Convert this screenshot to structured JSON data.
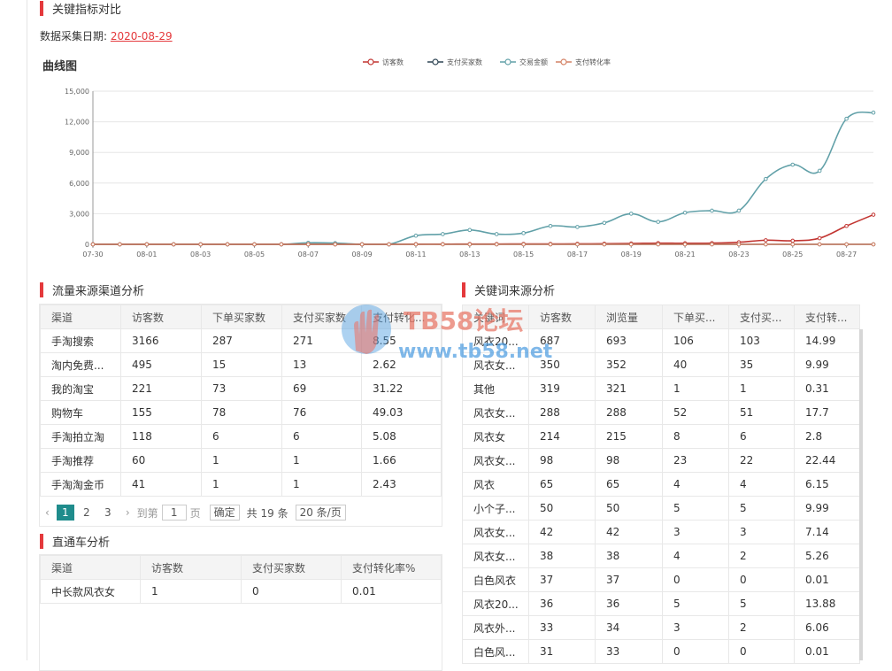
{
  "header": {
    "title": "关键指标对比",
    "date_label": "数据采集日期:",
    "date_value": "2020-08-29"
  },
  "chart": {
    "heading": "曲线图"
  },
  "chart_data": {
    "type": "line",
    "legend": [
      "访客数",
      "支付买家数",
      "交易金额",
      "支付转化率"
    ],
    "legend_position": "top-center",
    "colors": [
      "#c23531",
      "#2f4554",
      "#61a0a8",
      "#d48265"
    ],
    "x": [
      "07-30",
      "07-31",
      "08-01",
      "08-02",
      "08-03",
      "08-04",
      "08-05",
      "08-06",
      "08-07",
      "08-08",
      "08-09",
      "08-10",
      "08-11",
      "08-12",
      "08-13",
      "08-14",
      "08-15",
      "08-16",
      "08-17",
      "08-18",
      "08-19",
      "08-20",
      "08-21",
      "08-22",
      "08-23",
      "08-24",
      "08-25",
      "08-26",
      "08-27",
      "08-28"
    ],
    "x_tick_labels": [
      "07-30",
      "08-01",
      "08-03",
      "08-05",
      "08-07",
      "08-09",
      "08-11",
      "08-13",
      "08-15",
      "08-17",
      "08-19",
      "08-21",
      "08-23",
      "08-25",
      "08-27"
    ],
    "ylim": [
      0,
      15000
    ],
    "y_ticks": [
      "0",
      "3,000",
      "6,000",
      "9,000",
      "12,000",
      "15,000"
    ],
    "grid": true,
    "series": [
      {
        "name": "访客数",
        "values": [
          0,
          0,
          0,
          0,
          0,
          0,
          0,
          0,
          0,
          0,
          0,
          0,
          20,
          20,
          30,
          30,
          40,
          40,
          50,
          60,
          80,
          120,
          100,
          120,
          200,
          400,
          350,
          600,
          1800,
          2900
        ]
      },
      {
        "name": "支付买家数",
        "values": [
          0,
          0,
          0,
          0,
          0,
          0,
          0,
          0,
          0,
          0,
          0,
          0,
          0,
          0,
          0,
          0,
          0,
          0,
          0,
          0,
          0,
          0,
          0,
          0,
          0,
          0,
          0,
          0,
          0,
          0
        ]
      },
      {
        "name": "交易金额",
        "values": [
          0,
          0,
          0,
          0,
          0,
          0,
          0,
          0,
          150,
          120,
          0,
          0,
          850,
          1000,
          1400,
          1000,
          1100,
          1800,
          1700,
          2100,
          3000,
          2200,
          3100,
          3300,
          3300,
          6400,
          7800,
          7200,
          12300,
          12900
        ]
      },
      {
        "name": "支付转化率",
        "values": [
          0,
          0,
          0,
          0,
          0,
          0,
          0,
          0,
          0,
          0,
          0,
          0,
          0,
          0,
          0,
          0,
          0,
          0,
          0,
          0,
          0,
          0,
          0,
          0,
          0,
          0,
          0,
          0,
          0,
          0
        ]
      }
    ]
  },
  "traffic": {
    "title": "流量来源渠道分析",
    "columns": [
      "渠道",
      "访客数",
      "下单买家数",
      "支付买家数",
      "支付转化..."
    ],
    "rows": [
      [
        "手淘搜索",
        "3166",
        "287",
        "271",
        "8.55"
      ],
      [
        "淘内免费...",
        "495",
        "15",
        "13",
        "2.62"
      ],
      [
        "我的淘宝",
        "221",
        "73",
        "69",
        "31.22"
      ],
      [
        "购物车",
        "155",
        "78",
        "76",
        "49.03"
      ],
      [
        "手淘拍立淘",
        "118",
        "6",
        "6",
        "5.08"
      ],
      [
        "手淘推荐",
        "60",
        "1",
        "1",
        "1.66"
      ],
      [
        "手淘淘金币",
        "41",
        "1",
        "1",
        "2.43"
      ]
    ],
    "pagination": {
      "pages": [
        "1",
        "2",
        "3"
      ],
      "goto_label": "到第",
      "goto_value": "1",
      "page_unit": "页",
      "confirm_label": "确定",
      "total_label": "共 19 条",
      "page_size_label": "20 条/页"
    }
  },
  "through_train": {
    "title": "直通车分析",
    "columns": [
      "渠道",
      "访客数",
      "支付买家数",
      "支付转化率%"
    ],
    "rows": [
      [
        "中长款风衣女",
        "1",
        "0",
        "0.01"
      ]
    ]
  },
  "keywords": {
    "title": "关键词来源分析",
    "columns": [
      "关键词",
      "访客数",
      "浏览量",
      "下单买...",
      "支付买...",
      "支付转..."
    ],
    "rows": [
      [
        "风衣20...",
        "687",
        "693",
        "106",
        "103",
        "14.99"
      ],
      [
        "风衣女...",
        "350",
        "352",
        "40",
        "35",
        "9.99"
      ],
      [
        "其他",
        "319",
        "321",
        "1",
        "1",
        "0.31"
      ],
      [
        "风衣女...",
        "288",
        "288",
        "52",
        "51",
        "17.7"
      ],
      [
        "风衣女",
        "214",
        "215",
        "8",
        "6",
        "2.8"
      ],
      [
        "风衣女...",
        "98",
        "98",
        "23",
        "22",
        "22.44"
      ],
      [
        "风衣",
        "65",
        "65",
        "4",
        "4",
        "6.15"
      ],
      [
        "小个子...",
        "50",
        "50",
        "5",
        "5",
        "9.99"
      ],
      [
        "风衣女...",
        "42",
        "42",
        "3",
        "3",
        "7.14"
      ],
      [
        "风衣女...",
        "38",
        "38",
        "4",
        "2",
        "5.26"
      ],
      [
        "白色风衣",
        "37",
        "37",
        "0",
        "0",
        "0.01"
      ],
      [
        "风衣20...",
        "36",
        "36",
        "5",
        "5",
        "13.88"
      ],
      [
        "风衣外...",
        "33",
        "34",
        "3",
        "2",
        "6.06"
      ],
      [
        "白色风...",
        "31",
        "33",
        "0",
        "0",
        "0.01"
      ]
    ]
  },
  "watermark": {
    "line1": "TB58论坛",
    "line2": "www.tb58.net"
  }
}
